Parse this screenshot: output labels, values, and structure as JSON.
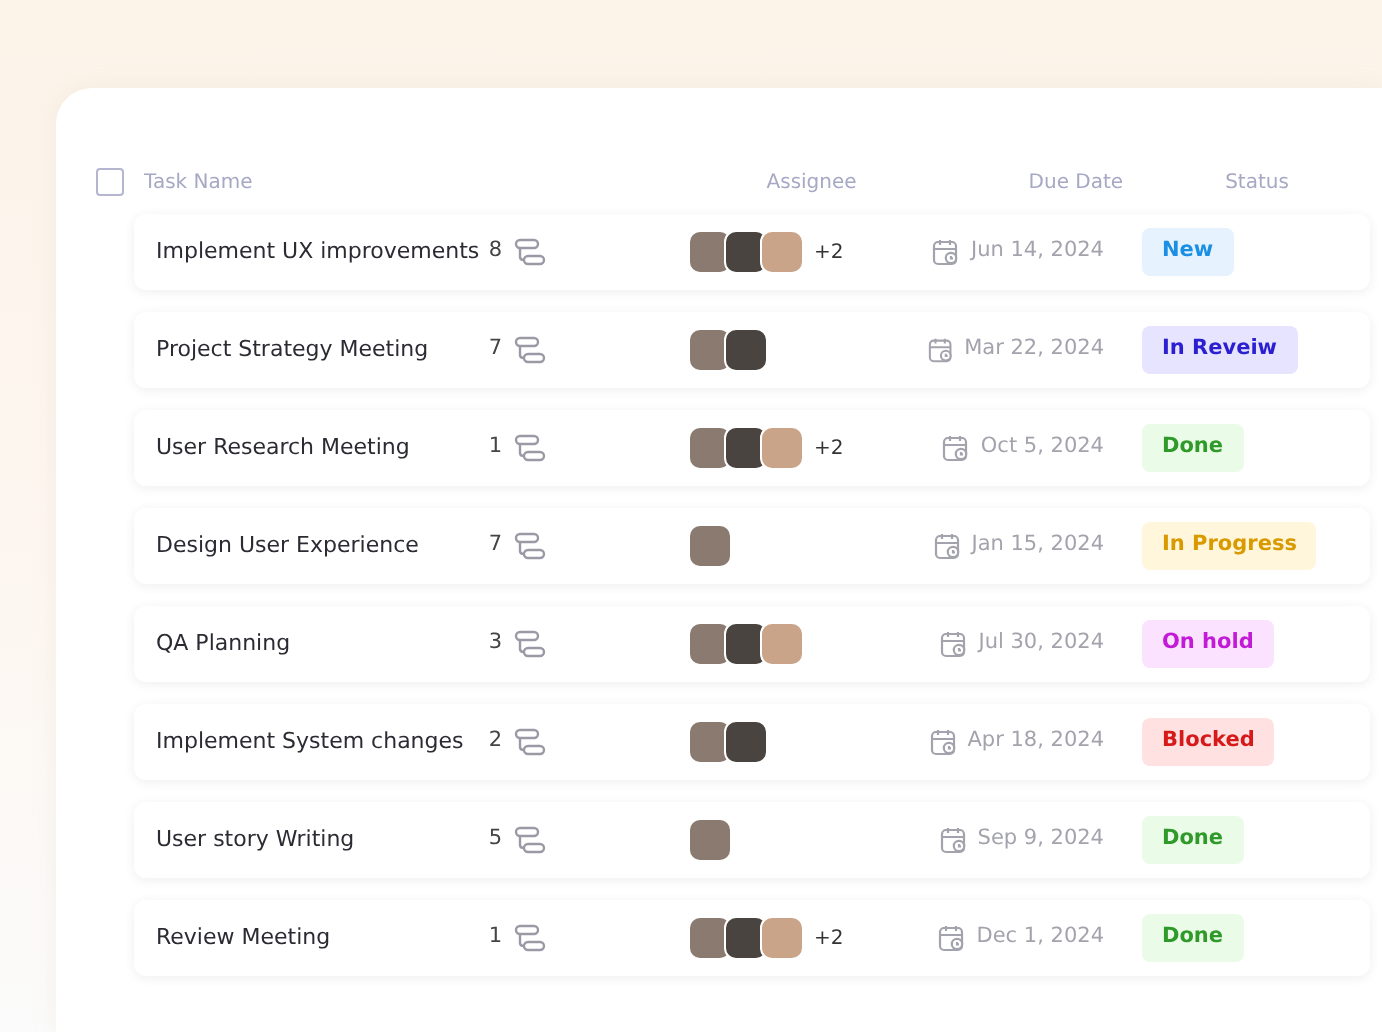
{
  "table": {
    "select_all": {
      "checked": false
    },
    "columns": [
      "Task Name",
      "Assignee",
      "Due Date",
      "Status"
    ],
    "rows": [
      {
        "name": "Implement UX improvements",
        "count": "8",
        "assignees": [
          {
            "kind": "photo"
          },
          {
            "kind": "photo"
          },
          {
            "kind": "photo"
          }
        ],
        "extra": "+2",
        "due": "Jun 14, 2024",
        "status": {
          "label": "New",
          "kind": "new"
        }
      },
      {
        "name": "Project Strategy Meeting",
        "count": "7",
        "assignees": [
          {
            "kind": "photo"
          },
          {
            "kind": "photo"
          }
        ],
        "due": "Mar 22, 2024",
        "status": {
          "label": "In Reveiw",
          "kind": "review"
        }
      },
      {
        "name": "User Research Meeting",
        "count": "1",
        "assignees": [
          {
            "kind": "photo"
          },
          {
            "kind": "photo"
          },
          {
            "kind": "photo"
          }
        ],
        "extra": "+2",
        "due": "Oct 5, 2024",
        "status": {
          "label": "Done",
          "kind": "done"
        }
      },
      {
        "name": "Design User Experience",
        "count": "7",
        "assignees": [
          {
            "kind": "photo"
          }
        ],
        "due": "Jan 15, 2024",
        "status": {
          "label": "In Progress",
          "kind": "progress"
        }
      },
      {
        "name": "QA Planning",
        "count": "3",
        "assignees": [
          {
            "kind": "photo"
          },
          {
            "kind": "photo"
          },
          {
            "kind": "photo"
          }
        ],
        "due": "Jul 30, 2024",
        "status": {
          "label": "On hold",
          "kind": "hold"
        }
      },
      {
        "name": "Implement System changes",
        "count": "2",
        "assignees": [
          {
            "kind": "photo"
          },
          {
            "kind": "photo"
          }
        ],
        "due": "Apr 18, 2024",
        "status": {
          "label": "Blocked",
          "kind": "blocked"
        }
      },
      {
        "name": "User story Writing",
        "count": "5",
        "assignees": [
          {
            "kind": "photo"
          }
        ],
        "due": "Sep 9, 2024",
        "status": {
          "label": "Done",
          "kind": "done"
        }
      },
      {
        "name": "Review Meeting",
        "count": "1",
        "assignees": [
          {
            "kind": "photo"
          },
          {
            "kind": "photo"
          },
          {
            "kind": "photo"
          }
        ],
        "extra": "+2",
        "due": "Dec 1, 2024",
        "status": {
          "label": "Done",
          "kind": "done"
        }
      }
    ]
  }
}
